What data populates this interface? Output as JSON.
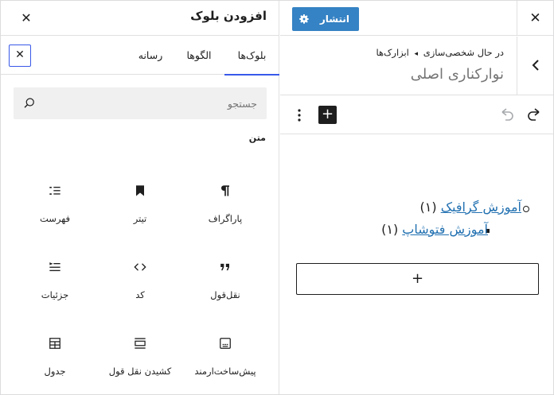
{
  "inserter": {
    "title": "افزودن بلوک",
    "tabs": [
      {
        "label": "بلوک‌ها",
        "active": true
      },
      {
        "label": "الگوها",
        "active": false
      },
      {
        "label": "رسانه",
        "active": false
      }
    ],
    "search": {
      "placeholder": "جستجو"
    },
    "category": "متن",
    "blocks": [
      {
        "label": "پاراگراف",
        "icon": "paragraph-icon"
      },
      {
        "label": "تیتر",
        "icon": "heading-bookmark-icon"
      },
      {
        "label": "فهرست",
        "icon": "list-icon"
      },
      {
        "label": "نقل‌قول",
        "icon": "quote-icon"
      },
      {
        "label": "کد",
        "icon": "code-icon"
      },
      {
        "label": "جزئیات",
        "icon": "details-icon"
      },
      {
        "label": "پیش‌ساخت‌ارمند",
        "icon": "preformatted-icon"
      },
      {
        "label": "کشیدن نقل قول",
        "icon": "pullquote-icon"
      },
      {
        "label": "جدول",
        "icon": "table-icon"
      }
    ]
  },
  "editor": {
    "publish_label": "انتشار",
    "breadcrumb": {
      "customizing": "در حال شخصی‌سازی",
      "separator": "◂",
      "section": "ابزارک‌ها"
    },
    "section_title": "نوارکناری اصلی",
    "list": [
      {
        "text": "آموزش گرافیک",
        "count": "(۱)"
      },
      {
        "text": "آموزش فتوشاپ",
        "count": "(۱)"
      }
    ],
    "appender_label": "+"
  },
  "colors": {
    "accent": "#3858e9",
    "publish": "#3582c4",
    "link": "#2271b1"
  }
}
